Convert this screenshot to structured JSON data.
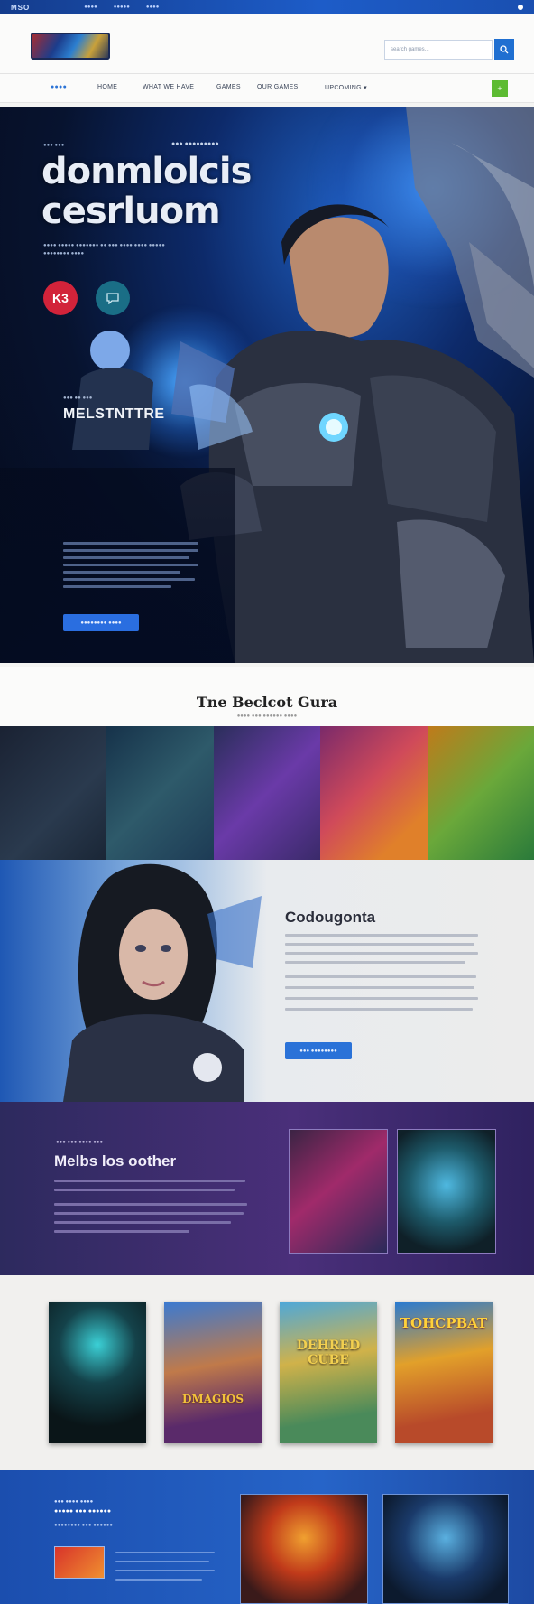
{
  "topbar": {
    "logo": "MSO",
    "links": [
      "●●●●",
      "●●●●●",
      "●●●●"
    ]
  },
  "header": {
    "search_placeholder": "search games...",
    "search_icon": "search-icon"
  },
  "nav": {
    "items": [
      "●●●●",
      "HOME",
      "WHAT WE HAVE",
      "GAMES",
      "OUR GAMES",
      "UPCOMING ▾"
    ],
    "cart_icon": "plus-icon"
  },
  "hero": {
    "eyebrow_left": "●●● ●●●",
    "eyebrow_right": "●●● ●●●●●●●●●",
    "title_line1": "donmlolcis",
    "title_line2": "cesrluom",
    "subtitle": "●●●● ●●●●● ●●●●●●● ●● ●●● ●●●● ●●●● ●●●●● ●●●●●●●● ●●●●",
    "badge_red": "K3",
    "badge_teal_icon": "chat-icon",
    "panel_eyebrow": "●●● ●● ●●●",
    "panel_title": "MELSTNTTRE",
    "panel_button": "●●●●●●●● ●●●●"
  },
  "band": {
    "title": "Tne Beclcot Gura",
    "subtitle": "●●●● ●●● ●●●●●● ●●●●"
  },
  "feature": {
    "title": "Codougonta",
    "button": "●●● ●●●●●●●●"
  },
  "purple": {
    "eyebrow": "●●● ●●● ●●●● ●●●",
    "title": "Melbs los oother"
  },
  "posters": [
    {
      "label": "",
      "icon": "poster-dark-warrior"
    },
    {
      "label": "DMAGIOS",
      "icon": "poster-fantasy-heroine"
    },
    {
      "label": "DEHRED CUBE",
      "icon": "poster-adventure"
    },
    {
      "label": "TOHCPBAT",
      "icon": "poster-arcade"
    }
  ],
  "footer": {
    "eyebrow": "●●● ●●●● ●●●●",
    "title": "●●●●● ●●● ●●●●●●",
    "subtitle": "●●●●●●●● ●●● ●●●●●●"
  },
  "colors": {
    "brand_blue": "#1f6fd1",
    "accent_green": "#5dbb32",
    "badge_red": "#d2233a",
    "badge_teal": "#1a6e86",
    "purple": "#4a2f7a"
  }
}
